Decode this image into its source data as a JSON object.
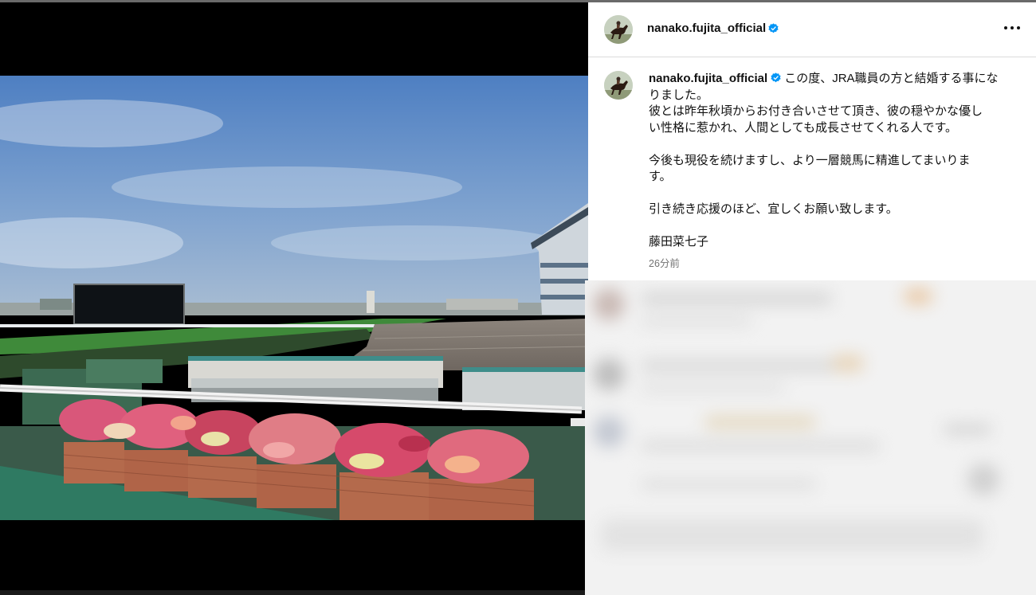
{
  "post": {
    "username": "nanako.fujita_official",
    "caption_lines": [
      "この度、JRA職員の方と結婚する事にな",
      "りました。",
      "彼とは昨年秋頃からお付き合いさせて頂き、彼の穏やかな優し",
      "い性格に惹かれ、人間としても成長させてくれる人です。",
      "",
      "今後も現役を続けますし、より一層競馬に精進してまいりま",
      "す。",
      "",
      "引き続き応援のほど、宜しくお願い致します。",
      "",
      "藤田菜七子"
    ],
    "timestamp": "26分前"
  },
  "icons": {
    "verified": "verified-badge-icon",
    "more": "more-options-icon",
    "avatar": "jockey-on-horse-avatar"
  },
  "colors": {
    "verified_blue": "#0095f6",
    "secondary_text": "#737373",
    "divider": "#dbdbdb"
  }
}
